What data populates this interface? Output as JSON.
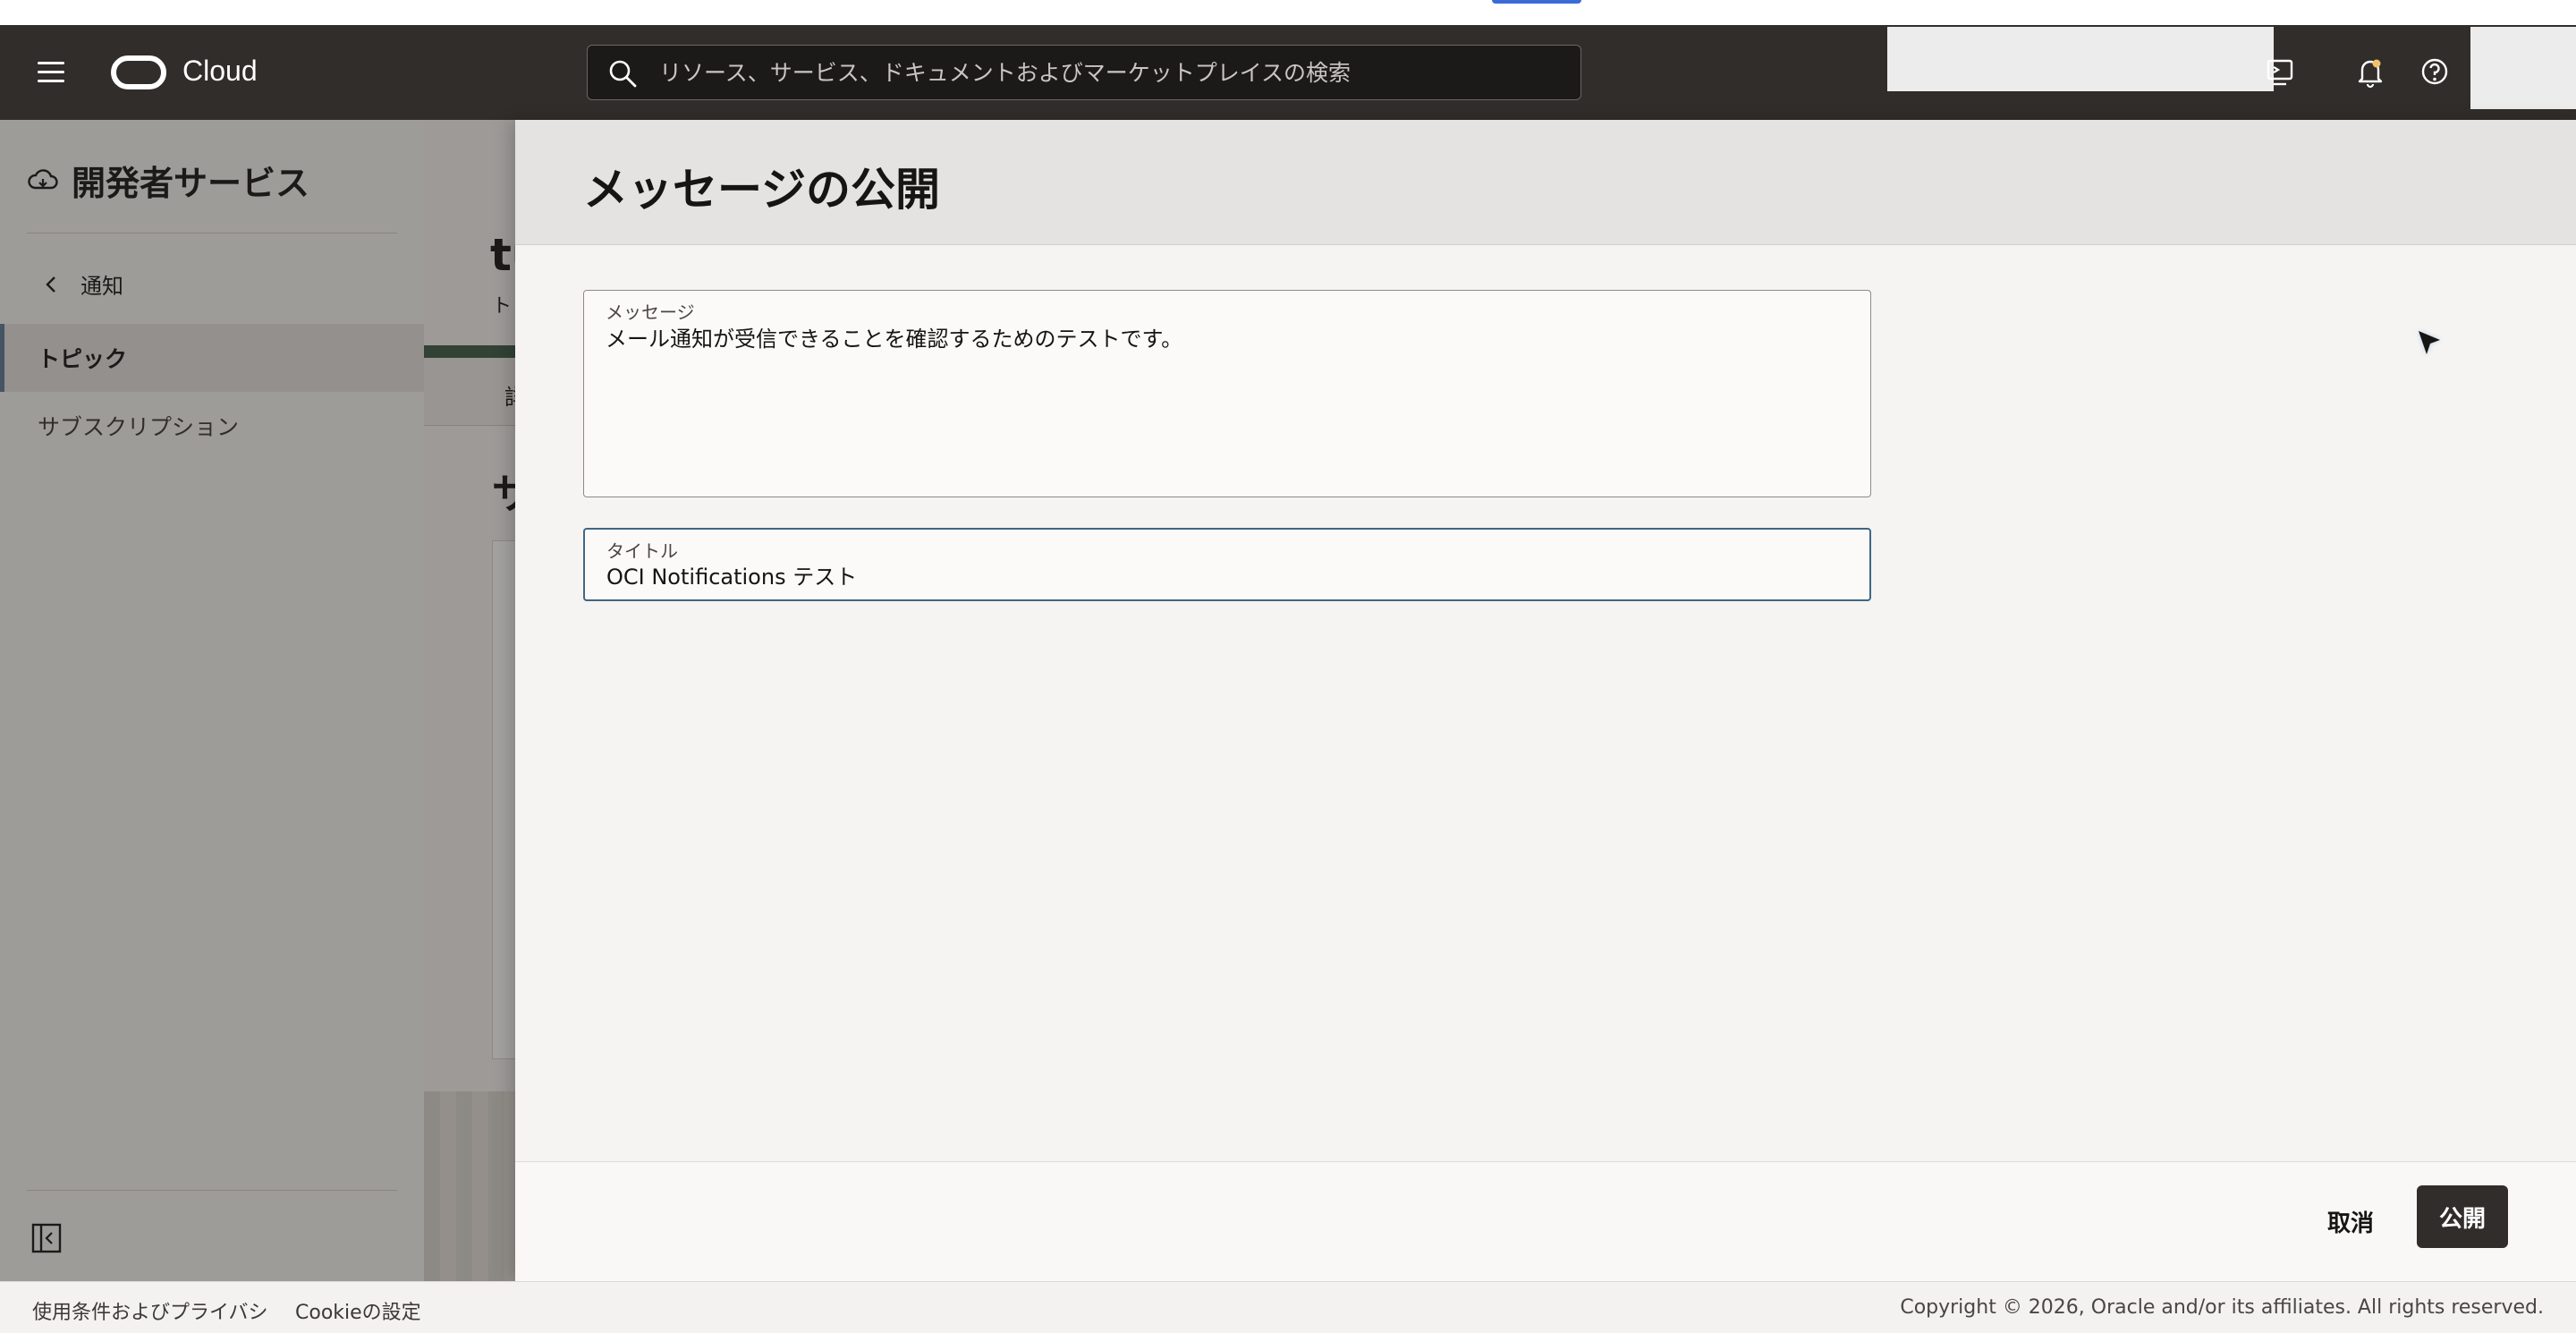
{
  "header": {
    "brand": "Cloud",
    "search_placeholder": "リソース、サービス、ドキュメントおよびマーケットプレイスの検索"
  },
  "sidebar": {
    "service_title": "開発者サービス",
    "back_label": "通知",
    "items": [
      {
        "label": "トピック",
        "active": true
      },
      {
        "label": "サブスクリプション",
        "active": false
      }
    ]
  },
  "background": {
    "title_fragment": "tu",
    "subtitle_fragment": "ト",
    "tab_fragment": "詳",
    "section_fragment": "サ"
  },
  "drawer": {
    "title": "メッセージの公開",
    "message_label": "メッセージ",
    "message_value": "メール通知が受信できることを確認するためのテストです。",
    "title_label": "タイトル",
    "title_value": "OCI Notifications テスト",
    "cancel_label": "取消",
    "publish_label": "公開"
  },
  "footer": {
    "terms": "使用条件およびプライバシ",
    "cookie": "Cookieの設定",
    "copyright": "Copyright © 2026, Oracle and/or its affiliates. All rights reserved."
  },
  "colors": {
    "header_bg": "#312d2a",
    "accent_border": "#3e6685",
    "publish_button": "#312d2a"
  }
}
